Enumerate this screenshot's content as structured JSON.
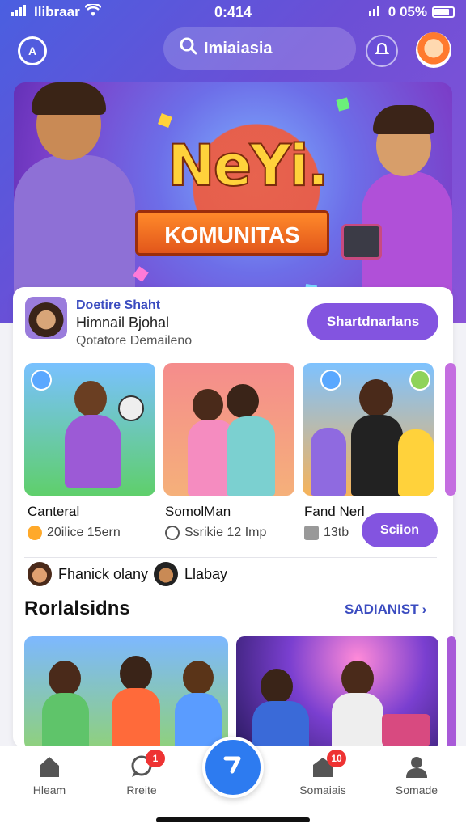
{
  "status": {
    "carrier": "Ilibraar",
    "time": "0:414",
    "battery": "0 05%"
  },
  "topnav": {
    "home_icon_label": "A",
    "search_text": "Imiaiasia"
  },
  "hero": {
    "title": "NeYi.",
    "ribbon": "KOMUNITAS"
  },
  "community": {
    "name": "Doetire Shaht",
    "subtitle": "Himnail Bjohal",
    "meta": "Qotatore Demaileno",
    "join_label": "Shartdnarlans"
  },
  "tiles": [
    {
      "title": "Canteral",
      "stat": "20ilice 15ern"
    },
    {
      "title": "SomolMan",
      "stat": "Ssrikie 12 Imp"
    },
    {
      "title": "Fand Nerl",
      "stat": "13tb"
    }
  ],
  "tile_join_label": "Sciion",
  "members": [
    {
      "name": "Fhanick olany"
    },
    {
      "name": "Llabay"
    }
  ],
  "section": {
    "title": "Rorlalsidns",
    "link": "SADIANIST",
    "link_chevron": "›"
  },
  "tabs": [
    {
      "label": "Hleam",
      "icon": "home-icon"
    },
    {
      "label": "Rreite",
      "icon": "chat-icon",
      "badge": "1"
    },
    {
      "label": "Somaiais",
      "icon": "community-icon",
      "badge": "10"
    },
    {
      "label": "Somade",
      "icon": "profile-icon"
    }
  ],
  "colors": {
    "accent": "#8354e0",
    "primary": "#2d7bf0",
    "link": "#3b4cc0",
    "badge": "#e33333"
  }
}
